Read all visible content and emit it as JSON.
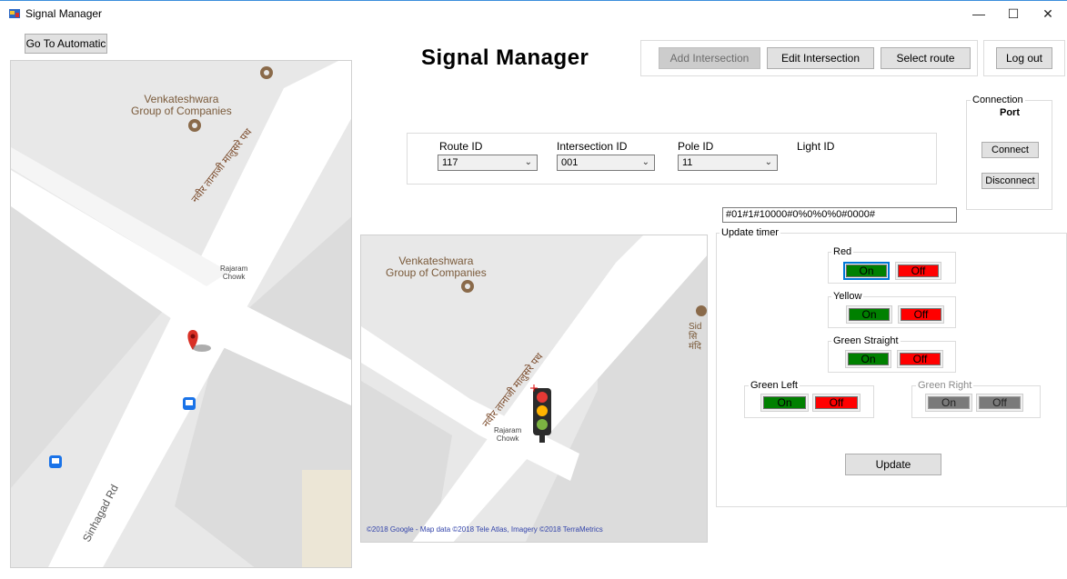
{
  "window": {
    "title": "Signal Manager",
    "minimize_glyph": "—",
    "maximize_glyph": "☐",
    "close_glyph": "✕"
  },
  "toolbar": {
    "go_to_automatic": "Go To Automatic",
    "add_intersection": "Add Intersection",
    "edit_intersection": "Edit Intersection",
    "select_route": "Select route",
    "log_out": "Log out"
  },
  "heading": "Signal Manager",
  "connection": {
    "group_label": "Connection",
    "port_label": "Port",
    "connect": "Connect",
    "disconnect": "Disconnect"
  },
  "selectors": {
    "route_id": {
      "label": "Route ID",
      "value": "117"
    },
    "intersection_id": {
      "label": "Intersection ID",
      "value": "001"
    },
    "pole_id": {
      "label": "Pole ID",
      "value": "11"
    },
    "light_id": {
      "label": "Light ID"
    },
    "dropdown_glyph": "⌄"
  },
  "command_text": "#01#1#10000#0%0%0%0#0000#",
  "update_timer": {
    "label": "Update timer",
    "red": {
      "label": "Red",
      "on": "On",
      "off": "Off"
    },
    "yellow": {
      "label": "Yellow",
      "on": "On",
      "off": "Off"
    },
    "green_straight": {
      "label": "Green Straight",
      "on": "On",
      "off": "Off"
    },
    "green_left": {
      "label": "Green Left",
      "on": "On",
      "off": "Off"
    },
    "green_right": {
      "label": "Green Right",
      "on": "On",
      "off": "Off"
    },
    "update": "Update"
  },
  "map_left": {
    "poi": "Venkateshwara\nGroup of Companies",
    "poi_line1": "Venkateshwara",
    "poi_line2": "Group of Companies",
    "road_hindi": "नवीर तानाजी मालुसरे पथ",
    "chowk_line1": "Rajaram",
    "chowk_line2": "Chowk",
    "road2": "Sinhagad Rd"
  },
  "map_right": {
    "poi_line1": "Venkateshwara",
    "poi_line2": "Group of Companies",
    "road_hindi": "नवीर तानाजी मालुसरे पथ",
    "chowk_line1": "Rajaram",
    "chowk_line2": "Chowk",
    "side_text1": "Sid",
    "side_text2": "सि",
    "side_text3": "मंदि",
    "attribution": "©2018 Google - Map data ©2018 Tele Atlas, Imagery ©2018 TerraMetrics"
  },
  "colors": {
    "on_green": "#008000",
    "off_red": "#ff0000",
    "disabled_gray": "#7a7a7a",
    "map_bg": "#e5e3df",
    "road": "#ffffff",
    "poi_brown": "#8a6a4a"
  }
}
